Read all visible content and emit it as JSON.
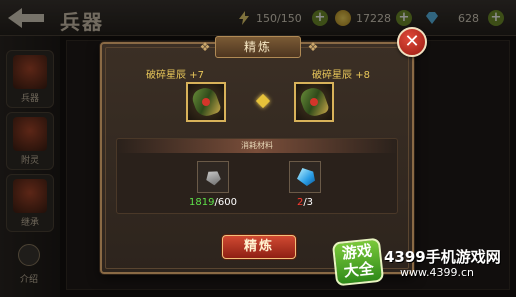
{
  "header": {
    "title": "兵器",
    "stamina": "150/150",
    "gold": "17228",
    "gems": "628"
  },
  "sidebar": {
    "items": [
      {
        "label": "兵器"
      },
      {
        "label": "附灵"
      },
      {
        "label": "继承"
      },
      {
        "label": "介绍"
      }
    ]
  },
  "dialog": {
    "title": "精炼",
    "close_icon": "close-icon",
    "current_item": {
      "name": "破碎星辰 +7",
      "icon": "gauntlet-icon"
    },
    "next_item": {
      "name": "破碎星辰 +8",
      "icon": "gauntlet-icon"
    },
    "materials": {
      "header": "消耗材料",
      "items": [
        {
          "icon": "stone-icon",
          "have": "1819",
          "need": "/600",
          "enough": true
        },
        {
          "icon": "crystal-icon",
          "have": "2",
          "need": "/3",
          "enough": false
        }
      ]
    },
    "refine_button": "精炼"
  },
  "watermark": {
    "badge_line1": "游戏",
    "badge_line2": "大全",
    "text": "4399手机游戏网",
    "url": "www.4399.cn"
  },
  "colors": {
    "accent_gold": "#e8c75a",
    "enough": "#5ee04a",
    "insufficient": "#ff3b30",
    "button_red": "#d04a32"
  }
}
